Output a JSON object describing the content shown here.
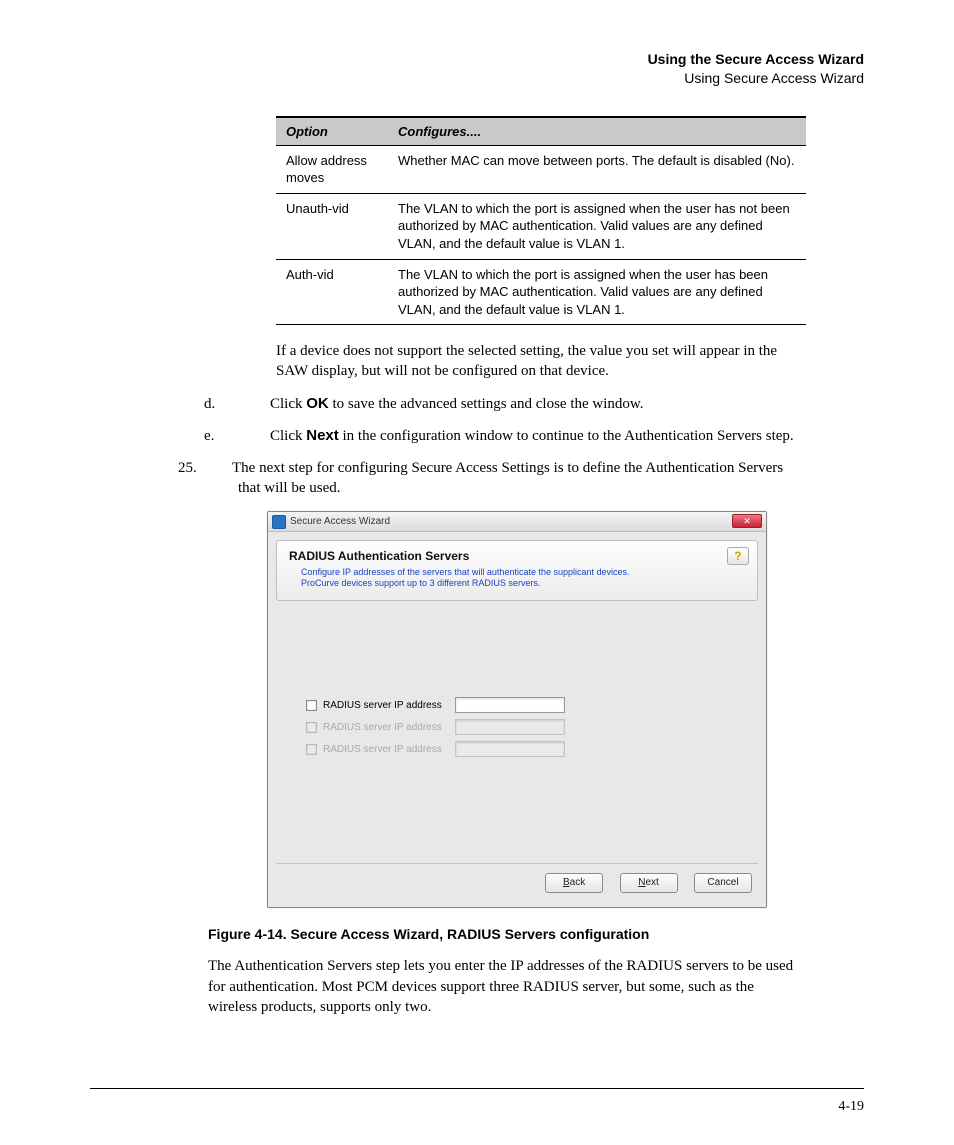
{
  "header": {
    "title": "Using the Secure Access Wizard",
    "subtitle": "Using Secure Access Wizard"
  },
  "table": {
    "col1": "Option",
    "col2": "Configures....",
    "rows": [
      {
        "option": "Allow address moves",
        "desc": "Whether MAC can move between ports. The default is disabled (No)."
      },
      {
        "option": "Unauth-vid",
        "desc": "The VLAN to which the port is assigned when the user has not been authorized by MAC authentication. Valid values are any defined VLAN, and the default value is VLAN 1."
      },
      {
        "option": "Auth-vid",
        "desc": "The VLAN to which the port is assigned when the user has been authorized by MAC authentication. Valid values are any defined VLAN, and the default value is VLAN 1."
      }
    ]
  },
  "after_table": "If a device does not support the selected setting, the value you set will appear in the SAW display, but will not be configured on that device.",
  "step_d": {
    "marker": "d.",
    "pre": "Click ",
    "bold": "OK",
    "post": " to save the advanced settings and close the window."
  },
  "step_e": {
    "marker": "e.",
    "pre": "Click ",
    "bold": "Next",
    "post": " in the configuration window to continue to the Authentication Servers step."
  },
  "step_25": {
    "marker": "25.",
    "text": "The next step for configuring Secure Access Settings is to define the Authenti­cation Servers that will be used."
  },
  "wizard": {
    "window_title": "Secure Access Wizard",
    "close_symbol": "✕",
    "help_symbol": "?",
    "panel_title": "RADIUS Authentication Servers",
    "panel_desc_line1": "Configure IP addresses of the servers that will authenticate the supplicant devices.",
    "panel_desc_line2": "ProCurve devices support up to 3 different RADIUS servers.",
    "row_label": "RADIUS server IP address",
    "buttons": {
      "back": "Back",
      "next": "Next",
      "cancel": "Cancel"
    }
  },
  "figure_caption": "Figure 4-14. Secure Access Wizard, RADIUS Servers configuration",
  "after_figure": "The Authentication Servers step lets you enter the IP addresses of the RADIUS servers to be used for authentication. Most PCM devices support three RADIUS server, but some, such as the wireless products, supports only two.",
  "page_number": "4-19"
}
